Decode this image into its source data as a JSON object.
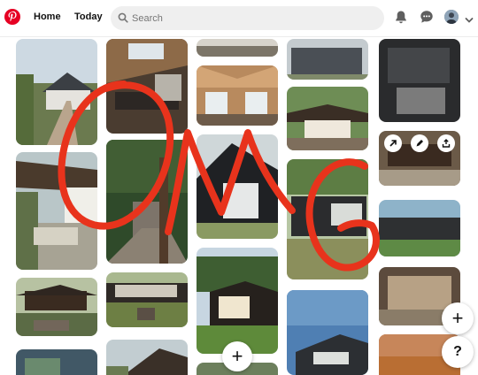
{
  "header": {
    "logo_icon": "pinterest-logo",
    "nav": [
      {
        "label": "Home"
      },
      {
        "label": "Today"
      }
    ],
    "search": {
      "placeholder": "Search",
      "value": ""
    },
    "icons": [
      "bell-icon",
      "chat-icon",
      "avatar",
      "chevron-down-icon"
    ]
  },
  "pin_actions": [
    "send-icon",
    "edit-icon",
    "share-icon"
  ],
  "overlay_text": "OMG",
  "overlay_color": "#e8331c",
  "fab": {
    "add_symbol": "+",
    "help_symbol": "?"
  }
}
